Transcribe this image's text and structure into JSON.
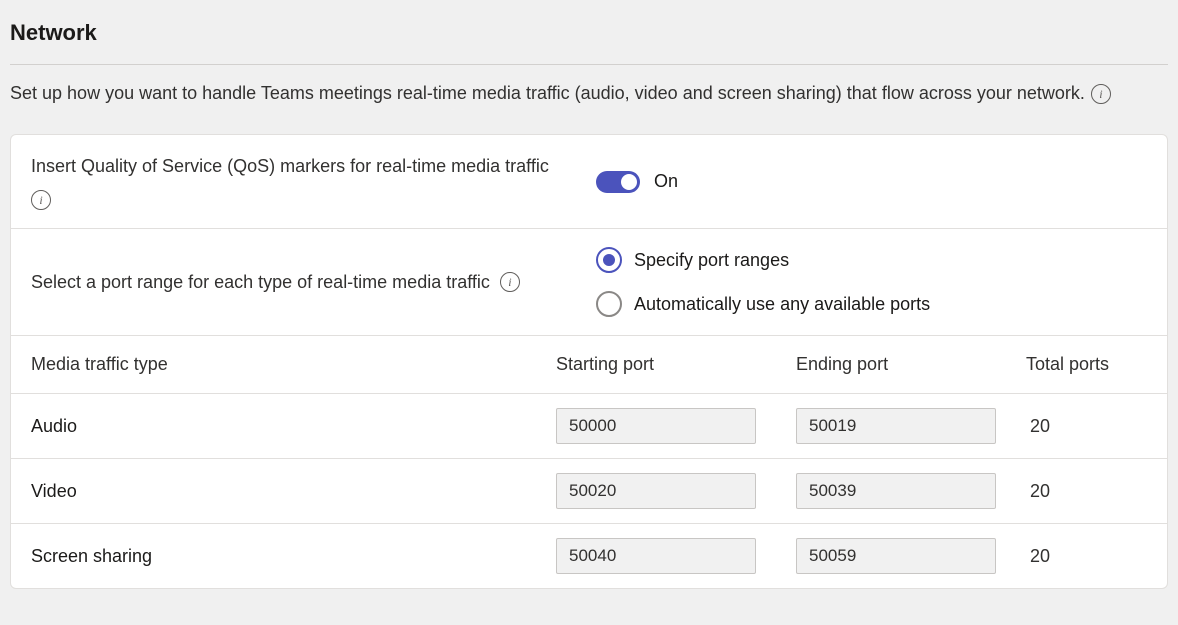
{
  "header": {
    "title": "Network",
    "description": "Set up how you want to handle Teams meetings real-time media traffic (audio, video and screen sharing) that flow across your network."
  },
  "settings": {
    "qos": {
      "label": "Insert Quality of Service (QoS) markers for real-time media traffic",
      "toggle_state": "On"
    },
    "port_range": {
      "label": "Select a port range for each type of real-time media traffic",
      "option_specify": "Specify port ranges",
      "option_auto": "Automatically use any available ports"
    }
  },
  "table": {
    "headers": {
      "type": "Media traffic type",
      "start": "Starting port",
      "end": "Ending port",
      "total": "Total ports"
    },
    "rows": [
      {
        "type": "Audio",
        "start": "50000",
        "end": "50019",
        "total": "20"
      },
      {
        "type": "Video",
        "start": "50020",
        "end": "50039",
        "total": "20"
      },
      {
        "type": "Screen sharing",
        "start": "50040",
        "end": "50059",
        "total": "20"
      }
    ]
  }
}
